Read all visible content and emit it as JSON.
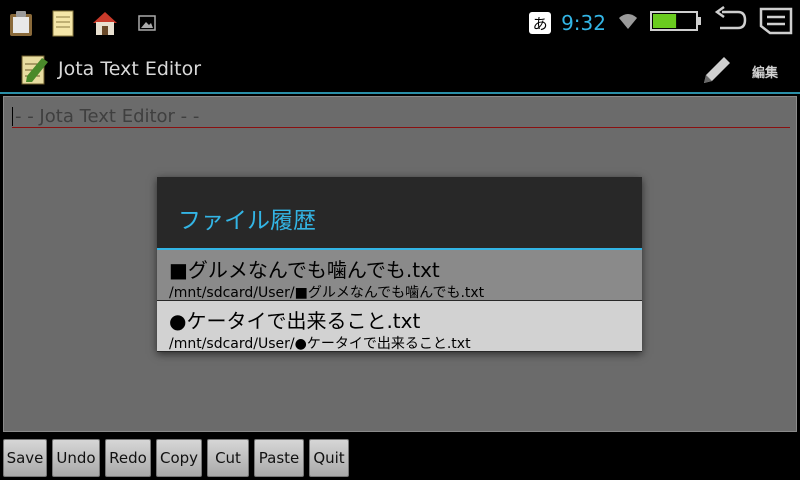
{
  "statusbar": {
    "icons": [
      "clipboard-app-icon",
      "notepad-app-icon",
      "home-app-icon",
      "image-notification-icon"
    ],
    "ime_label": "あ",
    "clock": "9:32",
    "right_icons": [
      "wifi-icon",
      "battery-icon",
      "back-icon",
      "menu-icon"
    ],
    "battery_level": 0.55,
    "accent_color": "#33b5e5"
  },
  "actionbar": {
    "title": "Jota Text Editor",
    "edit_label": "編集"
  },
  "editor": {
    "line1": "- - Jota Text Editor - -"
  },
  "dialog": {
    "title": "ファイル履歴",
    "items": [
      {
        "name": "■グルメなんでも噛んでも.txt",
        "path": "/mnt/sdcard/User/■グルメなんでも噛んでも.txt"
      },
      {
        "name": "●ケータイで出来ること.txt",
        "path": "/mnt/sdcard/User/●ケータイで出来ること.txt"
      }
    ]
  },
  "toolbar": {
    "buttons": [
      "Save",
      "Undo",
      "Redo",
      "Copy",
      "Cut",
      "Paste",
      "Quit"
    ]
  }
}
